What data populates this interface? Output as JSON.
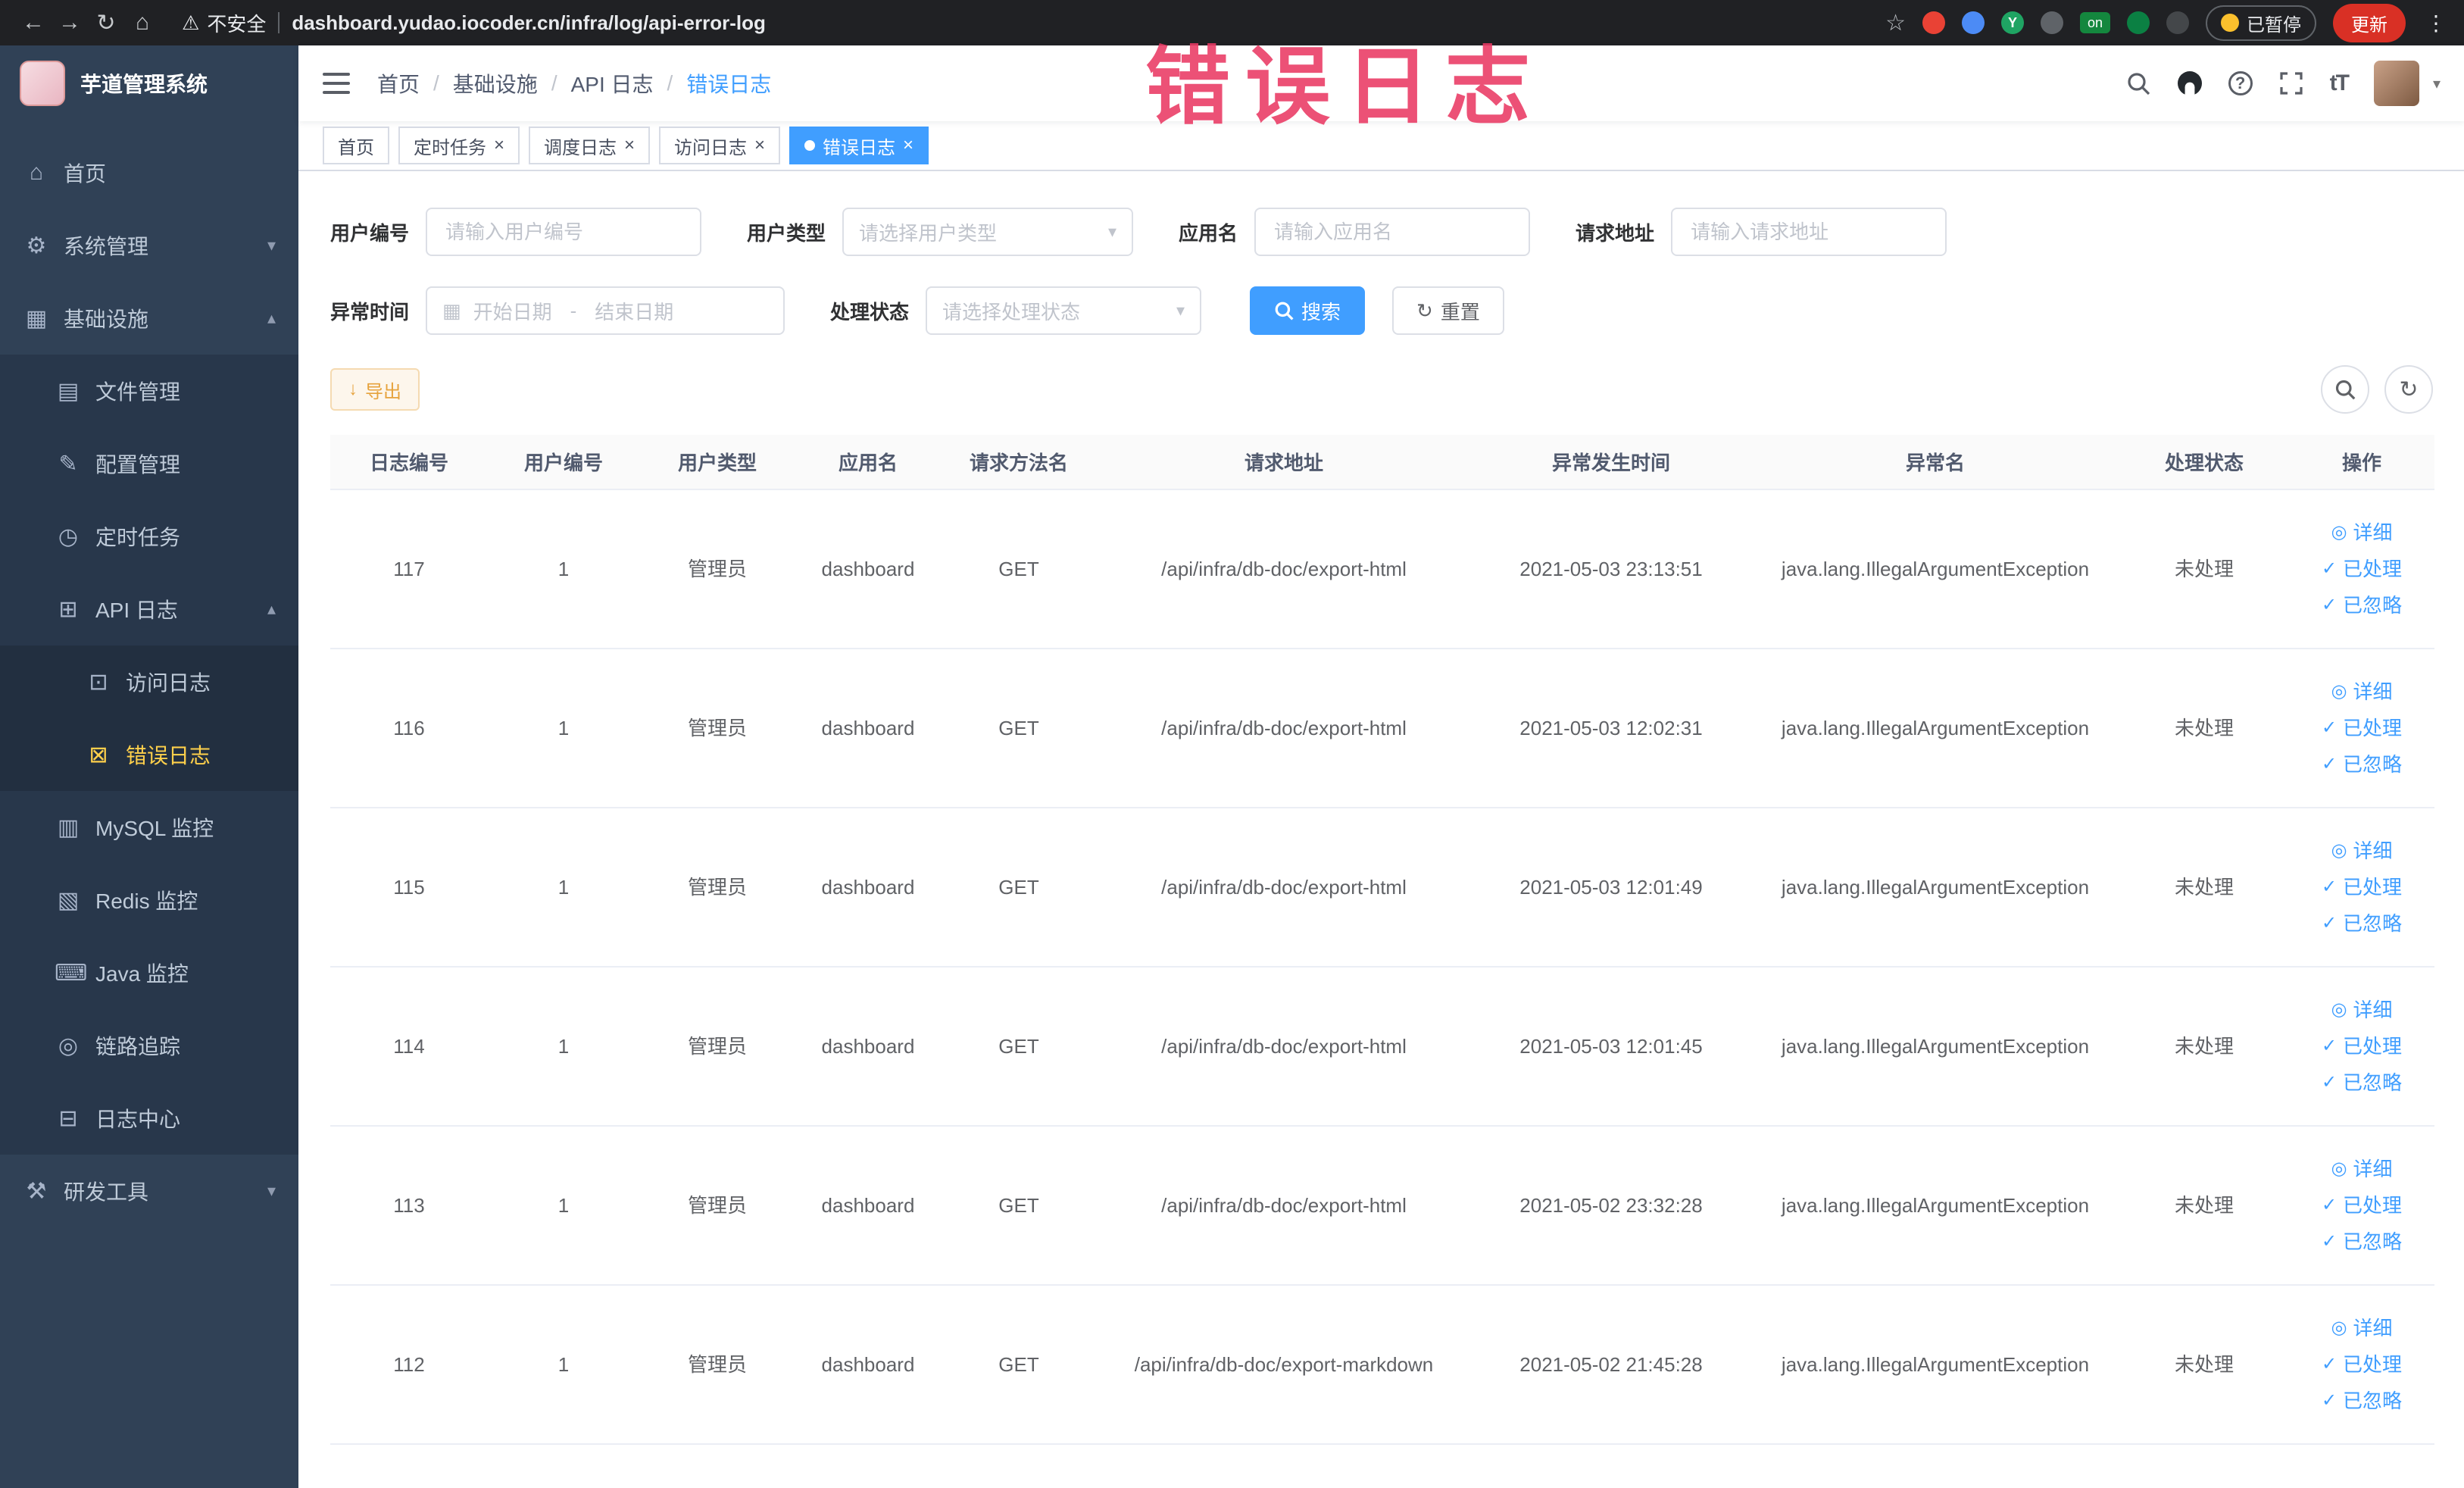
{
  "browser": {
    "security_label": "不安全",
    "url": "dashboard.yudao.iocoder.cn/infra/log/api-error-log",
    "extension_badge": "on",
    "paused_badge": "已暂停",
    "update_button": "更新",
    "proxy_letter": "Y"
  },
  "icons": {
    "back": "←",
    "forward": "→",
    "reload": "↻",
    "home": "⌂",
    "warning": "⚠",
    "star": "☆",
    "kebab": "⋮",
    "caret_down": "▾",
    "caret_up": "▴",
    "calendar": "▦",
    "check": "✓",
    "eye": "◎",
    "refresh": "↻",
    "download": "↓",
    "separator": "/",
    "range_separator": "-",
    "question": "?",
    "text_size": "tT",
    "close": "×"
  },
  "annotation": {
    "text": "错误日志"
  },
  "sidebar": {
    "title": "芋道管理系统",
    "items": [
      {
        "label": "首页",
        "glyph": "⌂"
      },
      {
        "label": "系统管理",
        "glyph": "⚙"
      },
      {
        "label": "基础设施",
        "glyph": "▦"
      },
      {
        "label": "文件管理",
        "glyph": "▤"
      },
      {
        "label": "配置管理",
        "glyph": "✎"
      },
      {
        "label": "定时任务",
        "glyph": "◷"
      },
      {
        "label": "API 日志",
        "glyph": "⊞"
      },
      {
        "label": "访问日志",
        "glyph": "⊡"
      },
      {
        "label": "错误日志",
        "glyph": "⊠"
      },
      {
        "label": "MySQL 监控",
        "glyph": "▥"
      },
      {
        "label": "Redis 监控",
        "glyph": "▧"
      },
      {
        "label": "Java 监控",
        "glyph": "⌨"
      },
      {
        "label": "链路追踪",
        "glyph": "◎"
      },
      {
        "label": "日志中心",
        "glyph": "⊟"
      },
      {
        "label": "研发工具",
        "glyph": "⚒"
      }
    ]
  },
  "header": {
    "breadcrumb": [
      "首页",
      "基础设施",
      "API 日志",
      "错误日志"
    ]
  },
  "tags": [
    {
      "label": "首页"
    },
    {
      "label": "定时任务"
    },
    {
      "label": "调度日志"
    },
    {
      "label": "访问日志"
    },
    {
      "label": "错误日志"
    }
  ],
  "filters": {
    "user_id_label": "用户编号",
    "user_id_placeholder": "请输入用户编号",
    "user_type_label": "用户类型",
    "user_type_placeholder": "请选择用户类型",
    "app_name_label": "应用名",
    "app_name_placeholder": "请输入应用名",
    "request_url_label": "请求地址",
    "request_url_placeholder": "请输入请求地址",
    "time_label": "异常时间",
    "time_start_placeholder": "开始日期",
    "time_end_placeholder": "结束日期",
    "status_label": "处理状态",
    "status_placeholder": "请选择处理状态",
    "search_button": "搜索",
    "reset_button": "重置"
  },
  "toolbar": {
    "export_button": "导出"
  },
  "table": {
    "columns": [
      "日志编号",
      "用户编号",
      "用户类型",
      "应用名",
      "请求方法名",
      "请求地址",
      "异常发生时间",
      "异常名",
      "处理状态",
      "操作"
    ],
    "actions": [
      "详细",
      "已处理",
      "已忽略"
    ],
    "rows": [
      {
        "id": "117",
        "user_id": "1",
        "user_type": "管理员",
        "app": "dashboard",
        "method": "GET",
        "url": "/api/infra/db-doc/export-html",
        "time": "2021-05-03 23:13:51",
        "exception": "java.lang.IllegalArgumentException",
        "status": "未处理"
      },
      {
        "id": "116",
        "user_id": "1",
        "user_type": "管理员",
        "app": "dashboard",
        "method": "GET",
        "url": "/api/infra/db-doc/export-html",
        "time": "2021-05-03 12:02:31",
        "exception": "java.lang.IllegalArgumentException",
        "status": "未处理"
      },
      {
        "id": "115",
        "user_id": "1",
        "user_type": "管理员",
        "app": "dashboard",
        "method": "GET",
        "url": "/api/infra/db-doc/export-html",
        "time": "2021-05-03 12:01:49",
        "exception": "java.lang.IllegalArgumentException",
        "status": "未处理"
      },
      {
        "id": "114",
        "user_id": "1",
        "user_type": "管理员",
        "app": "dashboard",
        "method": "GET",
        "url": "/api/infra/db-doc/export-html",
        "time": "2021-05-03 12:01:45",
        "exception": "java.lang.IllegalArgumentException",
        "status": "未处理"
      },
      {
        "id": "113",
        "user_id": "1",
        "user_type": "管理员",
        "app": "dashboard",
        "method": "GET",
        "url": "/api/infra/db-doc/export-html",
        "time": "2021-05-02 23:32:28",
        "exception": "java.lang.IllegalArgumentException",
        "status": "未处理"
      },
      {
        "id": "112",
        "user_id": "1",
        "user_type": "管理员",
        "app": "dashboard",
        "method": "GET",
        "url": "/api/infra/db-doc/export-markdown",
        "time": "2021-05-02 21:45:28",
        "exception": "java.lang.IllegalArgumentException",
        "status": "未处理"
      }
    ]
  }
}
